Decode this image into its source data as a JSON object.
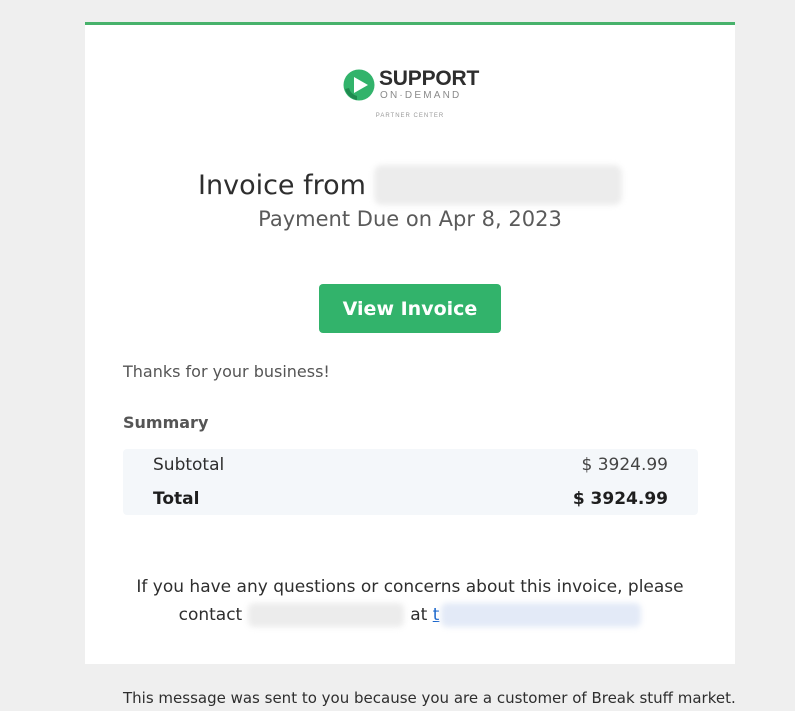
{
  "brand": {
    "name": "SUPPORT",
    "tagline": "ON·DEMAND",
    "sub_label": "PARTNER CENTER",
    "accent_color": "#32b36b"
  },
  "header": {
    "title_prefix": "Invoice from",
    "due_text": "Payment Due on Apr 8, 2023"
  },
  "actions": {
    "view_invoice_label": "View Invoice"
  },
  "body": {
    "thanks_text": "Thanks for your business!"
  },
  "summary": {
    "title": "Summary",
    "rows": [
      {
        "label": "Subtotal",
        "amount": "$ 3924.99"
      },
      {
        "label": "Total",
        "amount": "$ 3924.99"
      }
    ]
  },
  "contact": {
    "line1": "If you have any questions or concerns about this invoice, please",
    "line2_prefix": "contact",
    "line2_mid": "at",
    "link_visible_char": "t"
  },
  "footer": {
    "text": "This message was sent to you because you are a customer of Break stuff market."
  }
}
